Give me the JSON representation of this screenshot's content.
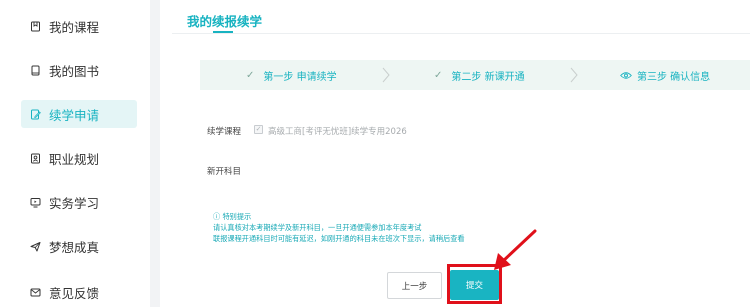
{
  "sidebar": {
    "items": [
      {
        "label": "我的课程",
        "icon": "bookmark-icon",
        "active": false
      },
      {
        "label": "我的图书",
        "icon": "book-icon",
        "active": false
      },
      {
        "label": "续学申请",
        "icon": "edit-document-icon",
        "active": true
      },
      {
        "label": "职业规划",
        "icon": "profile-card-icon",
        "active": false
      },
      {
        "label": "实务学习",
        "icon": "monitor-icon",
        "active": false
      },
      {
        "label": "梦想成真",
        "icon": "send-icon",
        "active": false
      },
      {
        "label": "意见反馈",
        "icon": "mail-icon",
        "active": false
      }
    ]
  },
  "main": {
    "title": "我的续报续学",
    "steps": [
      {
        "label": "第一步 申请续学",
        "icon": "check-icon"
      },
      {
        "label": "第二步 新课开通",
        "icon": "check-icon"
      },
      {
        "label": "第三步 确认信息",
        "icon": "eye-icon"
      }
    ],
    "form": {
      "course_label": "续学课程",
      "course_value": "高级工商[考评无忧班]续学专用2026",
      "new_subject_label": "新开科目"
    },
    "notice": {
      "title": "特别提示",
      "lines": [
        "请认真核对本考期续学及新开科目，一旦开通便需参加本年度考试",
        "联报课程开通科目时可能有延迟，如刚开通的科目未在班次下显示，请稍后查看"
      ]
    },
    "buttons": {
      "prev_label": "上一步",
      "submit_label": "提交"
    }
  },
  "colors": {
    "accent": "#18b3c1",
    "active_bg": "#e4f5f6",
    "steps_bg": "#eef6f3",
    "annotation_red": "#e0101a"
  }
}
